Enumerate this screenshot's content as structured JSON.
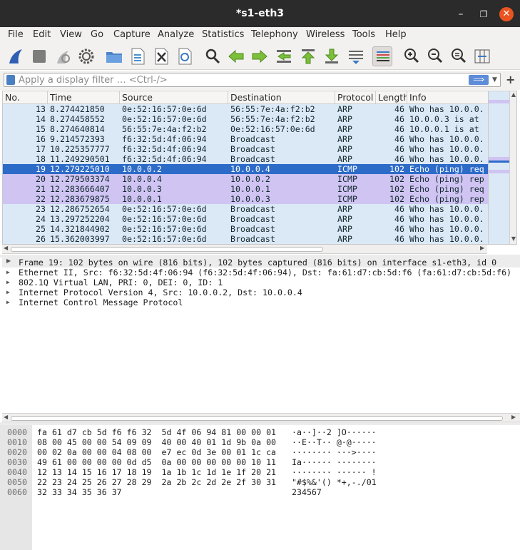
{
  "window": {
    "title": "*s1-eth3",
    "minimize": "–",
    "maximize": "❐",
    "close": "✕"
  },
  "menu": [
    "File",
    "Edit",
    "View",
    "Go",
    "Capture",
    "Analyze",
    "Statistics",
    "Telephony",
    "Wireless",
    "Tools",
    "Help"
  ],
  "toolbar": {
    "icons": [
      "shark-fin-start-icon",
      "stop-square-icon",
      "restart-capture-icon",
      "capture-options-gear-icon",
      "open-folder-icon",
      "save-file-icon",
      "close-file-icon",
      "reload-file-icon",
      "find-packet-icon",
      "go-back-icon",
      "go-forward-icon",
      "go-to-packet-icon",
      "go-first-packet-icon",
      "go-last-packet-icon",
      "autoscroll-icon",
      "colorize-icon",
      "zoom-in-icon",
      "zoom-out-icon",
      "zoom-normal-icon",
      "resize-columns-icon"
    ]
  },
  "filter": {
    "placeholder": "Apply a display filter … <Ctrl-/>",
    "apply": "⟹",
    "dropdown": "▼",
    "add": "+"
  },
  "packet_list": {
    "columns": [
      "No.",
      "Time",
      "Source",
      "Destination",
      "Protocol",
      "Length",
      "Info"
    ],
    "rows": [
      {
        "no": "13",
        "time": "8.274421850",
        "src": "0e:52:16:57:0e:6d",
        "dst": "56:55:7e:4a:f2:b2",
        "proto": "ARP",
        "len": "46",
        "info": "Who has 10.0.0.",
        "kind": "arp"
      },
      {
        "no": "14",
        "time": "8.274458552",
        "src": "0e:52:16:57:0e:6d",
        "dst": "56:55:7e:4a:f2:b2",
        "proto": "ARP",
        "len": "46",
        "info": "10.0.0.3 is at",
        "kind": "arp"
      },
      {
        "no": "15",
        "time": "8.274640814",
        "src": "56:55:7e:4a:f2:b2",
        "dst": "0e:52:16:57:0e:6d",
        "proto": "ARP",
        "len": "46",
        "info": "10.0.0.1 is at",
        "kind": "arp"
      },
      {
        "no": "16",
        "time": "9.214572393",
        "src": "f6:32:5d:4f:06:94",
        "dst": "Broadcast",
        "proto": "ARP",
        "len": "46",
        "info": "Who has 10.0.0.",
        "kind": "arp"
      },
      {
        "no": "17",
        "time": "10.225357777",
        "src": "f6:32:5d:4f:06:94",
        "dst": "Broadcast",
        "proto": "ARP",
        "len": "46",
        "info": "Who has 10.0.0.",
        "kind": "arp"
      },
      {
        "no": "18",
        "time": "11.249290501",
        "src": "f6:32:5d:4f:06:94",
        "dst": "Broadcast",
        "proto": "ARP",
        "len": "46",
        "info": "Who has 10.0.0.",
        "kind": "arp"
      },
      {
        "no": "19",
        "time": "12.279225010",
        "src": "10.0.0.2",
        "dst": "10.0.0.4",
        "proto": "ICMP",
        "len": "102",
        "info": "Echo (ping) req",
        "kind": "sel"
      },
      {
        "no": "20",
        "time": "12.279503374",
        "src": "10.0.0.4",
        "dst": "10.0.0.2",
        "proto": "ICMP",
        "len": "102",
        "info": "Echo (ping) rep",
        "kind": "icmp"
      },
      {
        "no": "21",
        "time": "12.283666407",
        "src": "10.0.0.3",
        "dst": "10.0.0.1",
        "proto": "ICMP",
        "len": "102",
        "info": "Echo (ping) req",
        "kind": "icmp"
      },
      {
        "no": "22",
        "time": "12.283679875",
        "src": "10.0.0.1",
        "dst": "10.0.0.3",
        "proto": "ICMP",
        "len": "102",
        "info": "Echo (ping) rep",
        "kind": "icmp"
      },
      {
        "no": "23",
        "time": "12.286752654",
        "src": "0e:52:16:57:0e:6d",
        "dst": "Broadcast",
        "proto": "ARP",
        "len": "46",
        "info": "Who has 10.0.0.",
        "kind": "arp"
      },
      {
        "no": "24",
        "time": "13.297252204",
        "src": "0e:52:16:57:0e:6d",
        "dst": "Broadcast",
        "proto": "ARP",
        "len": "46",
        "info": "Who has 10.0.0.",
        "kind": "arp"
      },
      {
        "no": "25",
        "time": "14.321844902",
        "src": "0e:52:16:57:0e:6d",
        "dst": "Broadcast",
        "proto": "ARP",
        "len": "46",
        "info": "Who has 10.0.0.",
        "kind": "arp"
      },
      {
        "no": "26",
        "time": "15.362003997",
        "src": "0e:52:16:57:0e:6d",
        "dst": "Broadcast",
        "proto": "ARP",
        "len": "46",
        "info": "Who has 10.0.0.",
        "kind": "arp"
      }
    ]
  },
  "colors": {
    "arp_row": "#dbe8f6",
    "icmp_row": "#cfc4f2",
    "selected_row": "#2d6bc8",
    "close_button": "#e95420"
  },
  "details": [
    "Frame 19: 102 bytes on wire (816 bits), 102 bytes captured (816 bits) on interface s1-eth3, id 0",
    "Ethernet II, Src: f6:32:5d:4f:06:94 (f6:32:5d:4f:06:94), Dst: fa:61:d7:cb:5d:f6 (fa:61:d7:cb:5d:f6)",
    "802.1Q Virtual LAN, PRI: 0, DEI: 0, ID: 1",
    "Internet Protocol Version 4, Src: 10.0.0.2, Dst: 10.0.0.4",
    "Internet Control Message Protocol"
  ],
  "bytes": [
    {
      "off": "0000",
      "hex": "fa 61 d7 cb 5d f6 f6 32  5d 4f 06 94 81 00 00 01",
      "ascii": "·a··]··2 ]O······"
    },
    {
      "off": "0010",
      "hex": "08 00 45 00 00 54 09 09  40 00 40 01 1d 9b 0a 00",
      "ascii": "··E··T·· @·@·····"
    },
    {
      "off": "0020",
      "hex": "00 02 0a 00 00 04 08 00  e7 ec 0d 3e 00 01 1c ca",
      "ascii": "········ ···>····"
    },
    {
      "off": "0030",
      "hex": "49 61 00 00 00 00 0d d5  0a 00 00 00 00 00 10 11",
      "ascii": "Ia······ ········"
    },
    {
      "off": "0040",
      "hex": "12 13 14 15 16 17 18 19  1a 1b 1c 1d 1e 1f 20 21",
      "ascii": "········ ······ !"
    },
    {
      "off": "0050",
      "hex": "22 23 24 25 26 27 28 29  2a 2b 2c 2d 2e 2f 30 31",
      "ascii": "\"#$%&'() *+,-./01"
    },
    {
      "off": "0060",
      "hex": "32 33 34 35 36 37",
      "ascii": "234567"
    }
  ]
}
